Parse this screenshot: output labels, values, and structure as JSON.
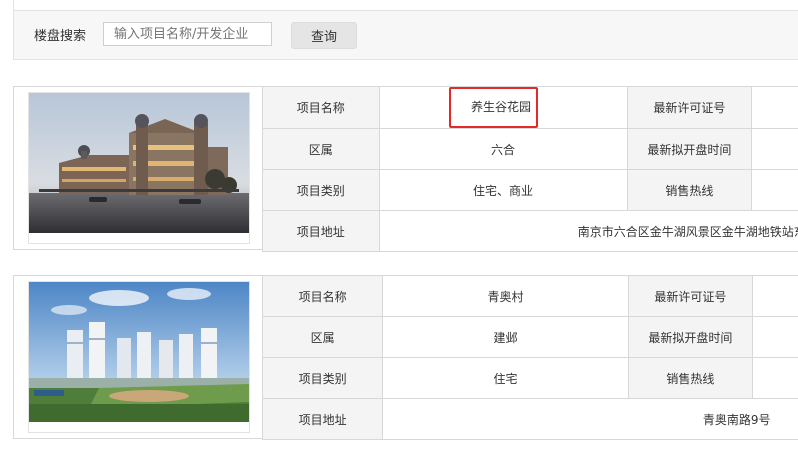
{
  "search": {
    "label": "楼盘搜索",
    "placeholder": "输入项目名称/开发企业",
    "button_label": "查询"
  },
  "columns": {
    "name": "项目名称",
    "district": "区属",
    "type": "项目类别",
    "address": "项目地址",
    "permit": "最新许可证号",
    "open_time": "最新拟开盘时间",
    "hotline": "销售热线"
  },
  "projects": [
    {
      "name": "养生谷花园",
      "district": "六合",
      "type": "住宅、商业",
      "address": "南京市六合区金牛湖风景区金牛湖地铁站东",
      "permit": "",
      "open_time": "",
      "hotline": ""
    },
    {
      "name": "青奥村",
      "district": "建邺",
      "type": "住宅",
      "address": "青奥南路9号",
      "permit": "",
      "open_time": "",
      "hotline": ""
    }
  ],
  "colors": {
    "highlight_border": "#e32a2a",
    "label_bg": "#f4f4f4",
    "button_bg": "#e5e5e5"
  }
}
